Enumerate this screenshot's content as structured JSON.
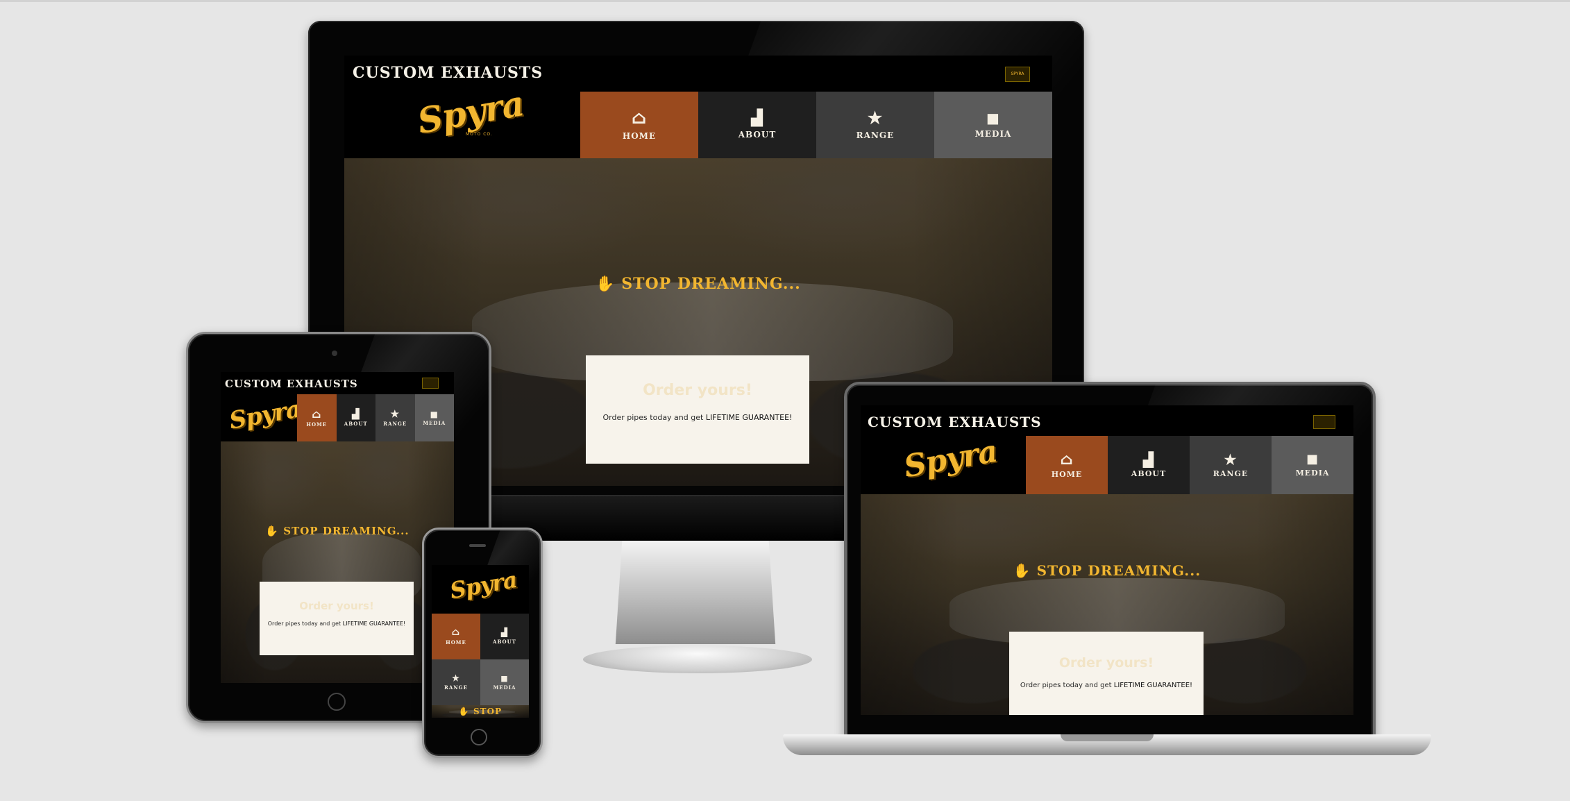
{
  "site": {
    "title": "CUSTOM EXHAUSTS",
    "logo": "Spyra",
    "logo_sub": "MOTO CO.",
    "badge": "SPYRA",
    "nav": [
      {
        "icon": "home-icon",
        "glyph": "⌂",
        "label": "HOME",
        "color": "#9a4a1e"
      },
      {
        "icon": "factory-icon",
        "glyph": "▟",
        "label": "ABOUT",
        "color": "#1f1f1f"
      },
      {
        "icon": "star-icon",
        "glyph": "★",
        "label": "RANGE",
        "color": "#3c3c3c"
      },
      {
        "icon": "video-icon",
        "glyph": "■",
        "label": "MEDIA",
        "color": "#5b5b5b"
      }
    ],
    "phone_about_label": "ABOUT",
    "hero_heading": "STOP DREAMING...",
    "hero_icon": "hand-icon",
    "phone_hero_partial": "STOP",
    "card_title": "Order yours!",
    "card_text": "Order pipes today and get",
    "card_highlight": "LIFETIME GUARANTEE!"
  },
  "colors": {
    "accent": "#f2b630",
    "home": "#9a4a1e",
    "background": "#e6e6e6",
    "card": "#f7f3eb"
  }
}
